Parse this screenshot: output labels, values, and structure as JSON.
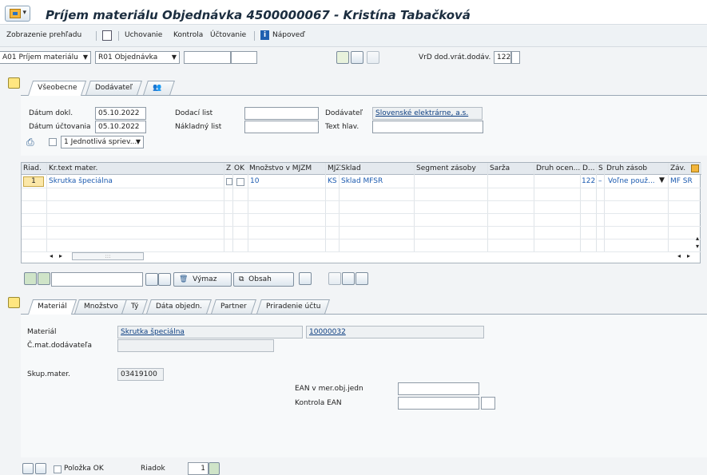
{
  "window": {
    "title": "Príjem materiálu Objednávka 4500000067 - Kristína Tabačková"
  },
  "menu": {
    "items": [
      "Zobrazenie prehľadu",
      "Uchovanie",
      "Kontrola",
      "Účtovanie",
      "Nápoveď"
    ]
  },
  "header": {
    "transaction": "A01 Príjem materiálu",
    "reference": "R01 Objednávka",
    "vrd_label": "VrD dod.vrát.dodáv.",
    "vrd_value": "122"
  },
  "header_tabs": [
    "Všeobecne",
    "Dodávateľ"
  ],
  "general": {
    "doc_date_label": "Dátum dokl.",
    "doc_date": "05.10.2022",
    "post_date_label": "Dátum účtovania",
    "post_date": "05.10.2022",
    "delivery_note_label": "Dodací list",
    "bill_of_lading_label": "Nákladný list",
    "vendor_label": "Dodávateľ",
    "vendor": "Slovenské elektrárne, a.s.",
    "header_text_label": "Text hlav.",
    "slip_option": "1 Jednotlivá spriev..."
  },
  "items_table": {
    "columns": [
      "Riad.",
      "Kr.text mater.",
      "Z",
      "OK",
      "Množstvo v MJZM",
      "MJZ",
      "Sklad",
      "Segment zásoby",
      "Šarža",
      "Druh ocen...",
      "D...",
      "S",
      "Druh zásob",
      "Záv."
    ],
    "rows": [
      {
        "line": "1",
        "text": "Skrutka špeciálna",
        "qty": "10",
        "uom": "KS",
        "sloc": "Sklad MFSR",
        "d": "122",
        "s": "–",
        "stock_type": "Voľne použ...",
        "plant": "MF SR"
      }
    ]
  },
  "toolbar": {
    "delete_label": "Výmaz",
    "content_label": "Obsah"
  },
  "detail_tabs": [
    "Materiál",
    "Množstvo",
    "Tý",
    "Dáta objedn.",
    "Partner",
    "Priradenie účtu"
  ],
  "material": {
    "material_label": "Materiál",
    "material_name": "Skrutka špeciálna",
    "material_number": "10000032",
    "vendor_mat_label": "Č.mat.dodávateľa",
    "mat_group_label": "Skup.mater.",
    "mat_group": "03419100",
    "ean_label": "EAN v mer.obj.jedn",
    "ean_check_label": "Kontrola EAN"
  },
  "footer": {
    "item_ok_label": "Položka OK",
    "line_label": "Riadok",
    "line_value": "1"
  }
}
